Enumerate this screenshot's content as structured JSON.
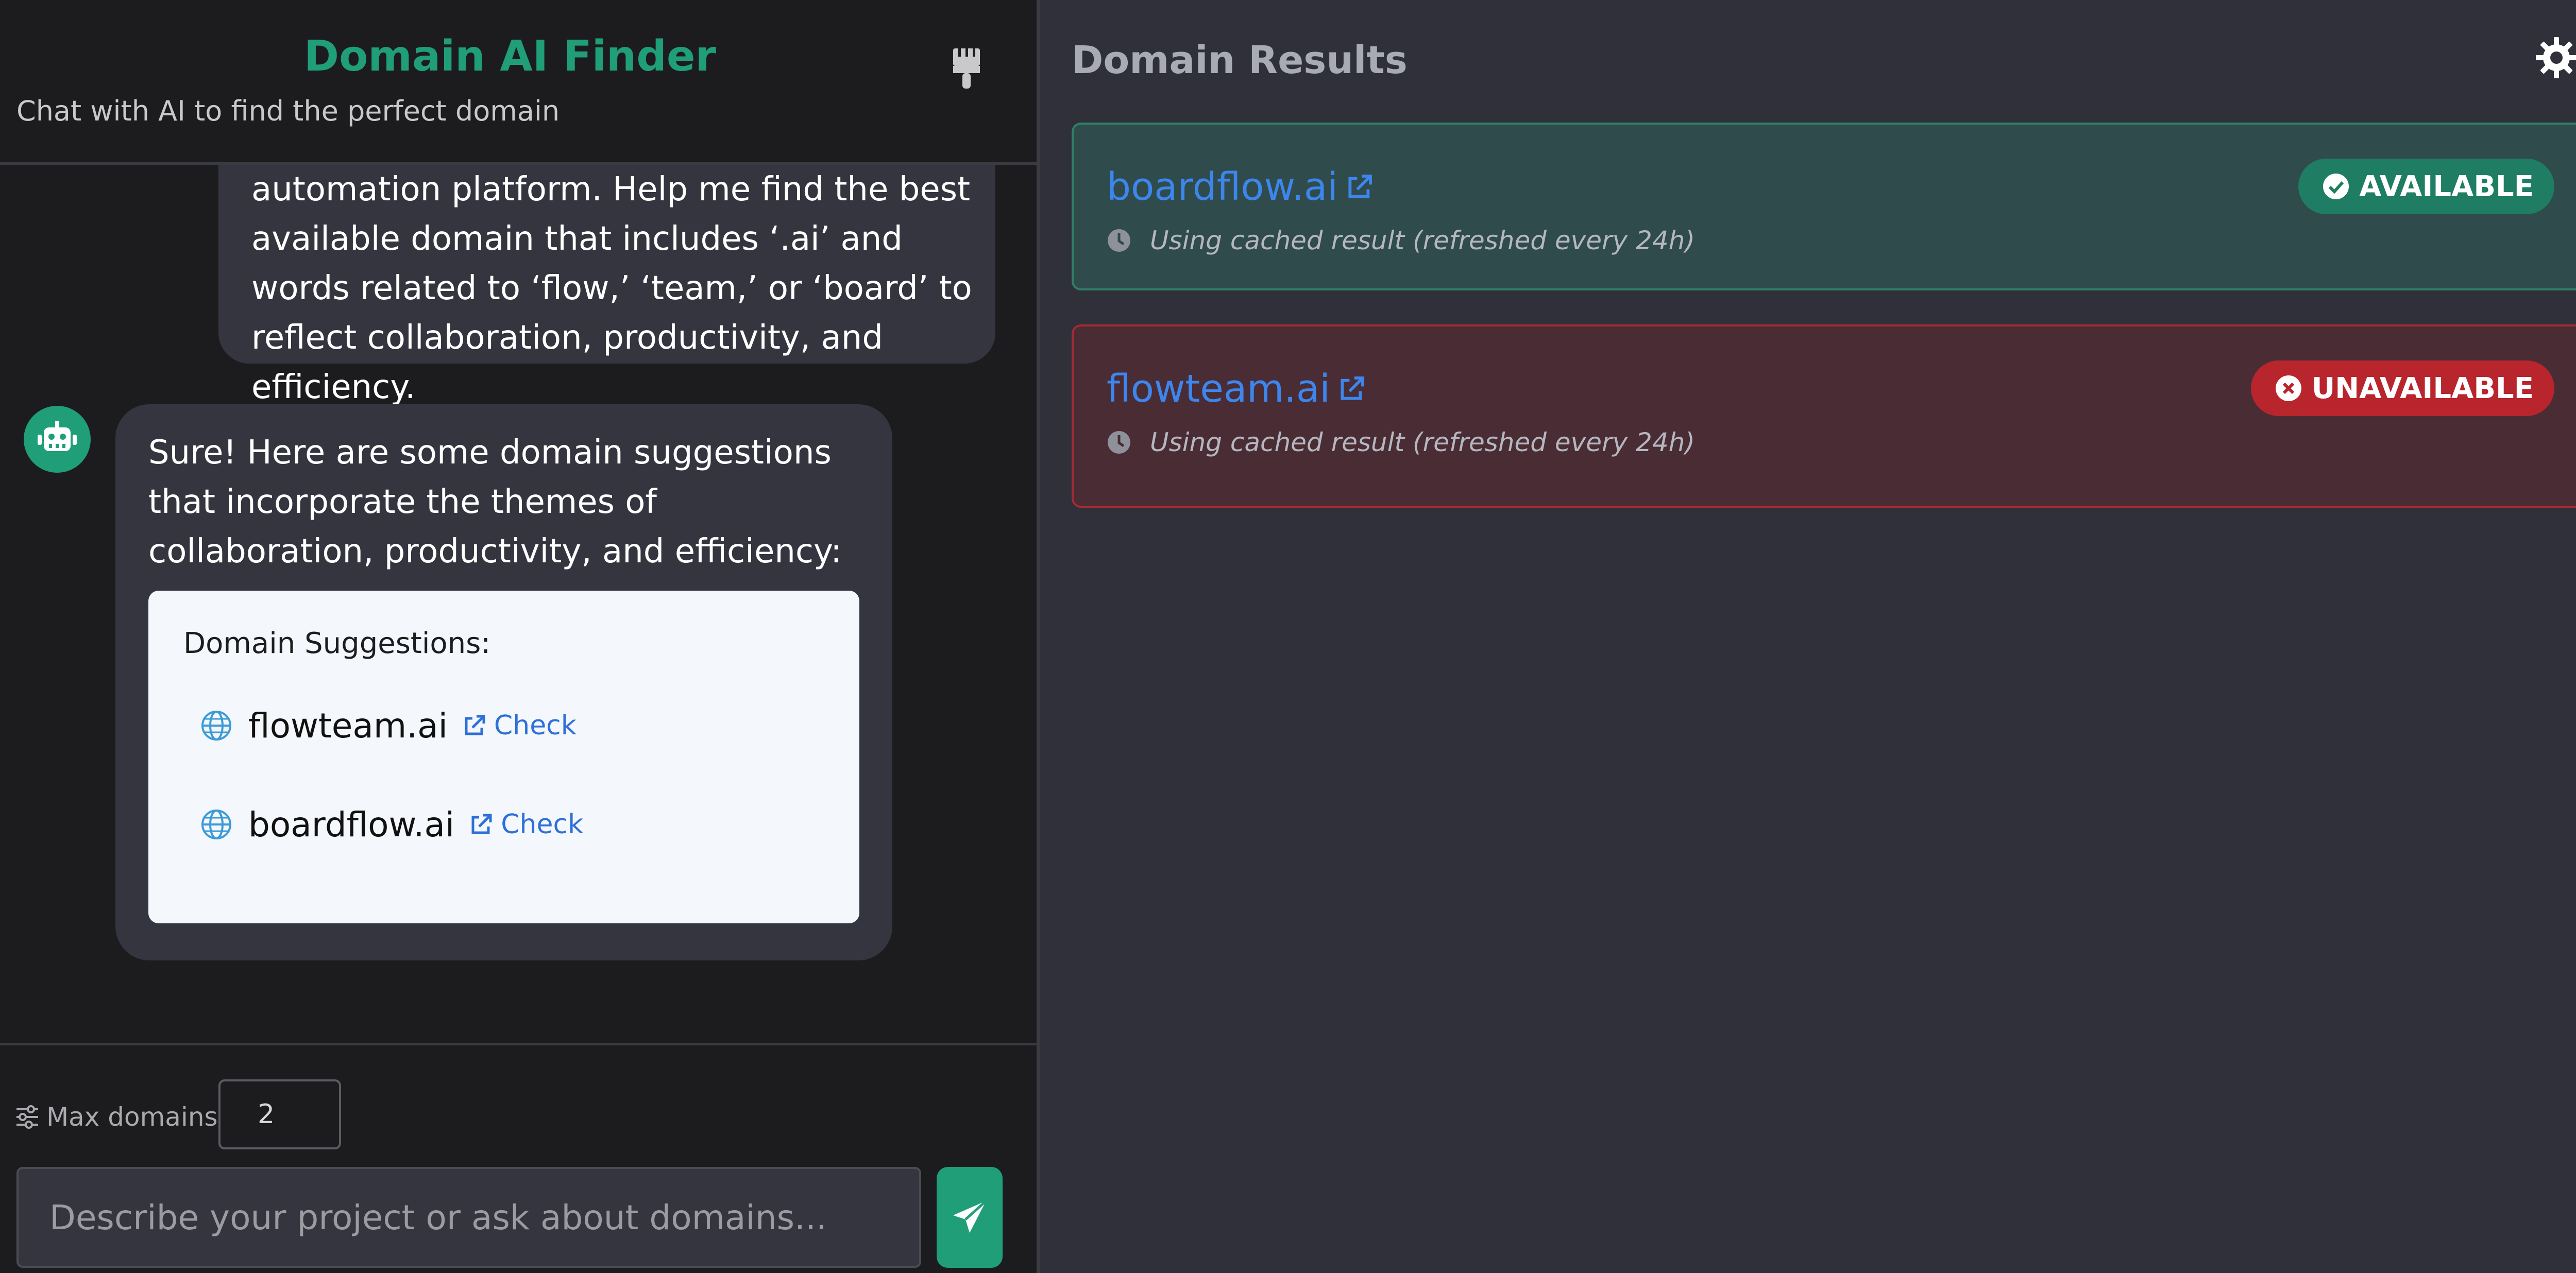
{
  "header": {
    "title": "Domain AI Finder",
    "subtitle": "Chat with AI to find the perfect domain"
  },
  "chat": {
    "user_message": "automation platform. Help me find the best available domain that includes ‘.ai’ and words related to ‘flow,’ ‘team,’ or ‘board’ to reflect collaboration, productivity, and efficiency.",
    "bot_message": "Sure! Here are some domain suggestions that incorporate the themes of collaboration, productivity, and efficiency:",
    "suggestions_title": "Domain Suggestions:",
    "suggestions": [
      {
        "domain": "flowteam.ai",
        "check_label": "Check"
      },
      {
        "domain": "boardflow.ai",
        "check_label": "Check"
      }
    ]
  },
  "controls": {
    "max_domains_label": "Max domains:",
    "max_domains_value": "2",
    "prompt_placeholder": "Describe your project or ask about domains..."
  },
  "results": {
    "title": "Domain Results",
    "items": [
      {
        "domain": "boardflow.ai",
        "status": "AVAILABLE",
        "note": "Using cached result (refreshed every 24h)"
      },
      {
        "domain": "flowteam.ai",
        "status": "UNAVAILABLE",
        "note": "Using cached result (refreshed every 24h)"
      }
    ]
  },
  "colors": {
    "accent": "#1f9e78",
    "link": "#3d86ee",
    "available": "#1e7d62",
    "unavailable": "#b8252d"
  }
}
